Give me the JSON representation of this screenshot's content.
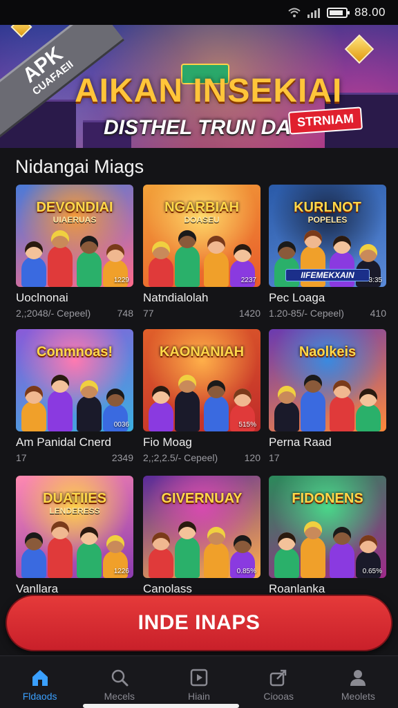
{
  "status_bar": {
    "time": "88.00",
    "battery_level_percent": 85
  },
  "banner": {
    "ribbon_line1": "APK",
    "ribbon_line2": "CUAFAEII",
    "title": "AIKAN INSEKIAI",
    "subtitle": "DISTHEL TRUN DA",
    "tag": "STRNIAM"
  },
  "section": {
    "title": "Nidangai Miags"
  },
  "games": [
    {
      "thumb_title": "DEVONDIAI",
      "thumb_sub": "UIAERUAS",
      "thumb_badge": "1229",
      "name": "Uoclnonai",
      "meta_left": "2,;2048/- Cepeel)",
      "meta_right": "748"
    },
    {
      "thumb_title": "NGARBIAH",
      "thumb_sub": "DOASEU",
      "thumb_badge": "2237",
      "name": "Natndialolah",
      "meta_left": "77",
      "meta_right": "1420"
    },
    {
      "thumb_title": "KURLNOT",
      "thumb_sub": "POPELES",
      "thumb_strip": "IIFEMEKXAIN",
      "thumb_badge": "3:35",
      "name": "Pec Loaga",
      "meta_left": "1.20-85/- Cepeel)",
      "meta_right": "410"
    },
    {
      "thumb_title": "Conmnoas!",
      "thumb_sub": "",
      "thumb_badge": "0036",
      "name": "Am Panidal Cnerd",
      "meta_left": "17",
      "meta_right": "2349"
    },
    {
      "thumb_title": "KAONANIAH",
      "thumb_sub": "",
      "thumb_badge": "515%",
      "name": "Fio Moag",
      "meta_left": "2,;2,2.5/- Cepeel)",
      "meta_right": "120"
    },
    {
      "thumb_title": "Naolkeis",
      "thumb_sub": "",
      "thumb_badge": "",
      "name": "Perna Raad",
      "meta_left": "17",
      "meta_right": ""
    },
    {
      "thumb_title": "DUATIIES",
      "thumb_sub": "LENDERESS",
      "thumb_badge": "1226",
      "name": "Vanllara",
      "meta_left": "",
      "meta_right": ""
    },
    {
      "thumb_title": "GIVERNUAY",
      "thumb_sub": "",
      "thumb_badge": "0.85%",
      "name": "Canolass",
      "meta_left": "",
      "meta_right": ""
    },
    {
      "thumb_title": "FIDONENS",
      "thumb_sub": "",
      "thumb_badge": "0.65%",
      "name": "Roanlanka",
      "meta_left": "",
      "meta_right": ""
    }
  ],
  "cta": {
    "label": "INDE INAPS"
  },
  "bottom_nav": [
    {
      "label": "Fldaods",
      "icon": "home-icon",
      "active": true
    },
    {
      "label": "Mecels",
      "icon": "search-icon",
      "active": false
    },
    {
      "label": "Hiain",
      "icon": "play-icon",
      "active": false
    },
    {
      "label": "Ciooas",
      "icon": "share-icon",
      "active": false
    },
    {
      "label": "Meolets",
      "icon": "profile-icon",
      "active": false
    }
  ],
  "colors": {
    "accent": "#3aa0ff",
    "cta": "#d62a30",
    "background": "#141417"
  }
}
